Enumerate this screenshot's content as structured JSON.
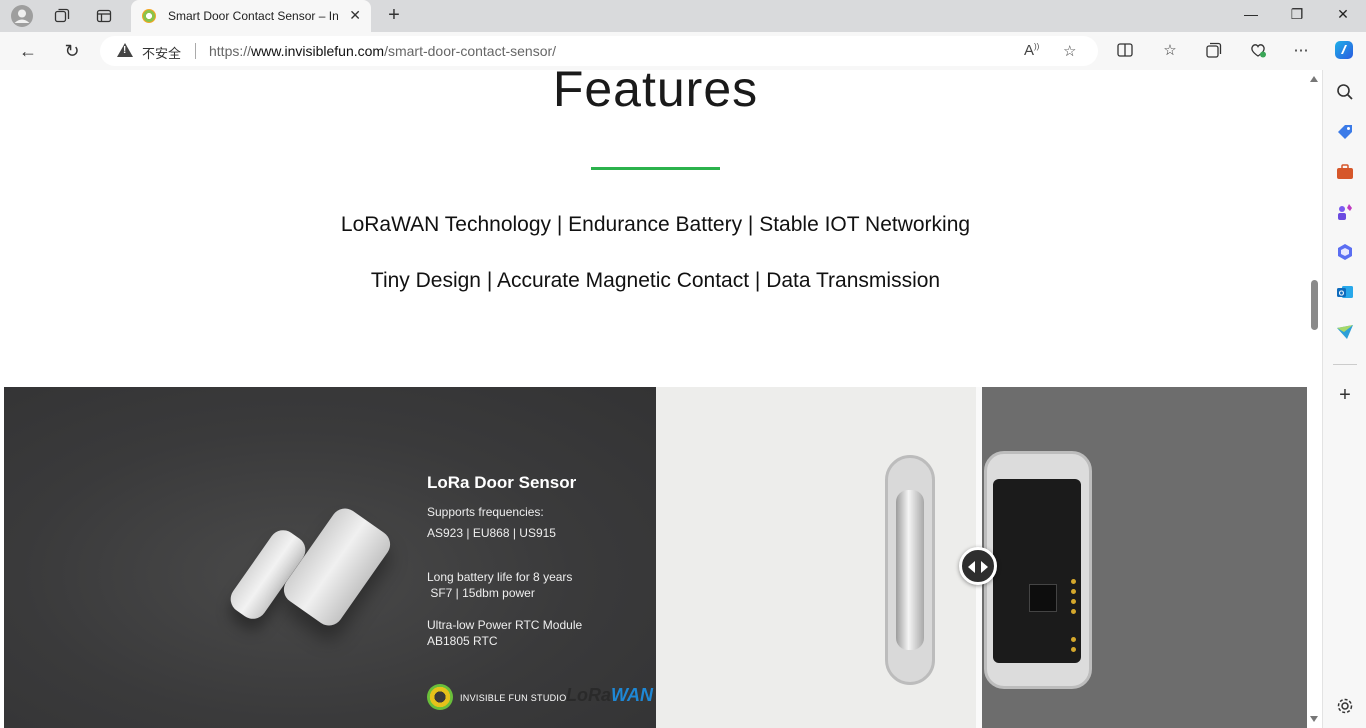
{
  "browser": {
    "tab_title": "Smart Door Contact Sensor – Inv",
    "security_label": "不安全",
    "url_prefix": "https://",
    "url_host": "www.invisiblefun.com",
    "url_path": "/smart-door-contact-sensor/"
  },
  "page": {
    "title": "Features",
    "feature_line_1": "LoRaWAN Technology | Endurance Battery | Stable IOT Networking",
    "feature_line_2": "Tiny Design | Accurate Magnetic Contact | Data Transmission"
  },
  "banner": {
    "title": "LoRa Door Sensor",
    "freq_label": "Supports frequencies:",
    "freqs": "AS923 | EU868 | US915",
    "battery_line_1": "Long battery life for 8 years",
    "battery_line_2": " SF7 | 15dbm power",
    "rtc_line_1": "Ultra-low Power RTC Module",
    "rtc_line_2": "AB1805 RTC",
    "studio": "INVISIBLE FUN STUDIO",
    "lorawan_lo": "LoRa",
    "lorawan_wan": "WAN"
  },
  "icons": {
    "profile": "profile-icon",
    "workspaces": "workspaces-icon",
    "tab_actions": "tab-actions-icon",
    "back": "back-arrow-icon",
    "refresh": "refresh-icon",
    "read_aloud": "read-aloud-icon",
    "favorite": "star-icon",
    "split": "split-screen-icon",
    "favorites": "favorites-icon",
    "collections": "collections-icon",
    "performance": "performance-icon",
    "more": "more-icon",
    "copilot": "copilot-icon"
  },
  "colors": {
    "accent_green": "#2bb24c",
    "banner_dark": "#3a3a3b",
    "lorawan_blue": "#1e88d6"
  }
}
